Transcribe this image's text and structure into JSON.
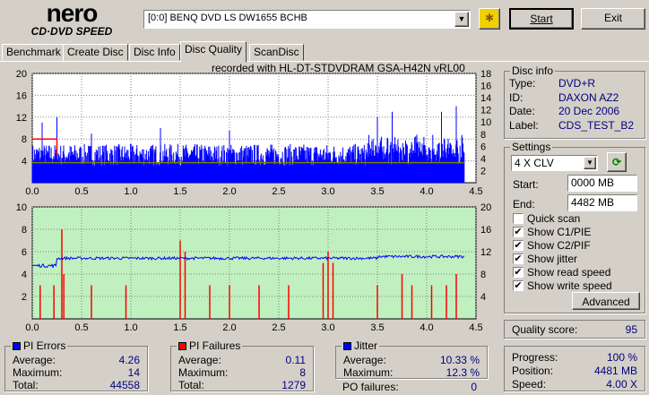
{
  "app": {
    "logo_top": "nero",
    "logo_bottom": "CD·DVD SPEED"
  },
  "toolbar": {
    "drive": "[0:0]  BENQ DVD LS DW1655 BCHB",
    "start": "Start",
    "exit": "Exit"
  },
  "tabs": [
    "Benchmark",
    "Create Disc",
    "Disc Info",
    "Disc Quality",
    "ScanDisc"
  ],
  "active_tab": "Disc Quality",
  "chart_header": "recorded with HL-DT-STDVDRAM GSA-H42N  vRL00",
  "disc_info": {
    "title": "Disc info",
    "type_label": "Type:",
    "type": "DVD+R",
    "id_label": "ID:",
    "id": "DAXON AZ2",
    "date_label": "Date:",
    "date": "20 Dec 2006",
    "label_label": "Label:",
    "label": "CDS_TEST_B2"
  },
  "settings": {
    "title": "Settings",
    "speed": "4 X CLV",
    "start_label": "Start:",
    "start": "0000 MB",
    "end_label": "End:",
    "end": "4482 MB",
    "checks": [
      {
        "label": "Quick scan",
        "checked": false
      },
      {
        "label": "Show C1/PIE",
        "checked": true
      },
      {
        "label": "Show C2/PIF",
        "checked": true
      },
      {
        "label": "Show jitter",
        "checked": true
      },
      {
        "label": "Show read speed",
        "checked": true
      },
      {
        "label": "Show write speed",
        "checked": true
      }
    ],
    "advanced": "Advanced"
  },
  "quality": {
    "label": "Quality score:",
    "value": "95"
  },
  "pi_errors": {
    "title": "PI Errors",
    "color": "#0000ff",
    "average_label": "Average:",
    "average": "4.26",
    "maximum_label": "Maximum:",
    "maximum": "14",
    "total_label": "Total:",
    "total": "44558"
  },
  "pi_failures": {
    "title": "PI Failures",
    "color": "#ff0000",
    "average_label": "Average:",
    "average": "0.11",
    "maximum_label": "Maximum:",
    "maximum": "8",
    "total_label": "Total:",
    "total": "1279"
  },
  "jitter": {
    "title": "Jitter",
    "color": "#0000ff",
    "average_label": "Average:",
    "average": "10.33 %",
    "maximum_label": "Maximum:",
    "maximum": "12.3 %",
    "po_label": "PO failures:",
    "po": "0"
  },
  "progress": {
    "progress_label": "Progress:",
    "progress": "100 %",
    "position_label": "Position:",
    "position": "4481 MB",
    "speed_label": "Speed:",
    "speed": "4.00 X"
  },
  "chart_data": [
    {
      "type": "bar",
      "title": "PI Errors",
      "xlim": [
        0,
        4.5
      ],
      "ylim": [
        0,
        20
      ],
      "y2lim": [
        0,
        18
      ],
      "xticks": [
        "0.0",
        "0.5",
        "1.0",
        "1.5",
        "2.0",
        "2.5",
        "3.0",
        "3.5",
        "4.0",
        "4.5"
      ],
      "yticks": [
        "4",
        "8",
        "12",
        "16",
        "20"
      ],
      "y2ticks": [
        "2",
        "4",
        "6",
        "8",
        "10",
        "12",
        "14",
        "16",
        "18"
      ],
      "x_end": 4.38,
      "baseline_level": 4.3,
      "spikes": [
        [
          0.1,
          11
        ],
        [
          0.25,
          12
        ],
        [
          0.6,
          9
        ],
        [
          1.3,
          10
        ],
        [
          2.0,
          9.5
        ],
        [
          3.5,
          12
        ],
        [
          3.65,
          13
        ],
        [
          4.15,
          13
        ],
        [
          4.3,
          14
        ]
      ],
      "read_speed_level": 3.3,
      "write_speed": "4x (red segment at 0–0.25)"
    },
    {
      "type": "bar",
      "title": "PI Failures / Jitter",
      "xlim": [
        0,
        4.5
      ],
      "ylim": [
        0,
        10
      ],
      "y2lim": [
        0,
        20
      ],
      "xticks": [
        "0.0",
        "0.5",
        "1.0",
        "1.5",
        "2.0",
        "2.5",
        "3.0",
        "3.5",
        "4.0",
        "4.5"
      ],
      "yticks": [
        "2",
        "4",
        "6",
        "8",
        "10"
      ],
      "y2ticks": [
        "4",
        "8",
        "12",
        "16",
        "20"
      ],
      "pif_spikes": [
        [
          0.08,
          3
        ],
        [
          0.22,
          3
        ],
        [
          0.3,
          8
        ],
        [
          0.32,
          4
        ],
        [
          0.6,
          3
        ],
        [
          0.95,
          3
        ],
        [
          1.5,
          7
        ],
        [
          1.55,
          6
        ],
        [
          1.8,
          3
        ],
        [
          2.0,
          3
        ],
        [
          2.3,
          3
        ],
        [
          2.6,
          3
        ],
        [
          2.95,
          5
        ],
        [
          3.0,
          6
        ],
        [
          3.05,
          5
        ],
        [
          3.5,
          3
        ],
        [
          3.75,
          4
        ],
        [
          3.85,
          3
        ],
        [
          4.05,
          3
        ],
        [
          4.2,
          3
        ],
        [
          4.3,
          4
        ]
      ],
      "jitter_avg_pct": 10.33,
      "jitter_start_pct": 9.2
    }
  ]
}
